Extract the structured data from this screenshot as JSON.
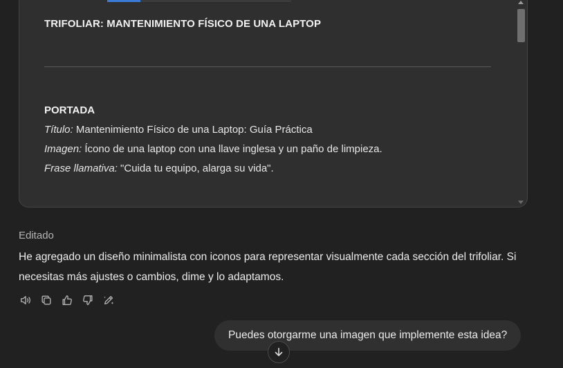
{
  "canvas": {
    "doc_title": "TRIFOLIAR: MANTENIMIENTO FÍSICO DE UNA LAPTOP",
    "section_heading": "PORTADA",
    "lines": [
      {
        "label": "Título:",
        "text": " Mantenimiento Físico de una Laptop: Guía Práctica"
      },
      {
        "label": "Imagen:",
        "text": " Ícono de una laptop con una llave inglesa y un paño de limpieza."
      },
      {
        "label": "Frase llamativa:",
        "text": " \"Cuida tu equipo, alarga su vida\"."
      }
    ]
  },
  "assistant": {
    "edited_label": "Editado",
    "message": "He agregado un diseño minimalista con iconos para representar visualmente cada sección del trifoliar. Si necesitas más ajustes o cambios, dime y lo adaptamos."
  },
  "actions": [
    {
      "icon": "speaker-icon"
    },
    {
      "icon": "copy-icon"
    },
    {
      "icon": "thumbs-up-icon"
    },
    {
      "icon": "thumbs-down-icon"
    },
    {
      "icon": "edit-canvas-icon"
    }
  ],
  "user": {
    "message": "Puedes otorgarme una imagen que implemente esta idea?"
  },
  "colors": {
    "background": "#212121",
    "canvas_bg": "#2f2f2f",
    "bubble_bg": "#303030",
    "accent": "#3a7bd5"
  }
}
